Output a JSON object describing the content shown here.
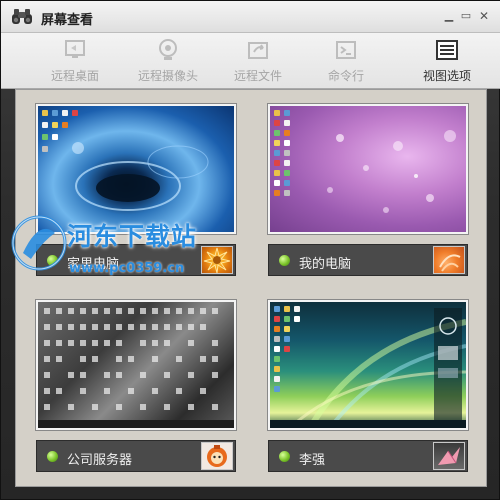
{
  "window": {
    "title": "屏幕查看",
    "controls": {
      "minimize": "▁",
      "maximize": "▭",
      "close": "✕"
    }
  },
  "toolbar": {
    "items": [
      {
        "label": "远程桌面",
        "icon": "remote-desktop-icon",
        "active": false
      },
      {
        "label": "远程摄像头",
        "icon": "webcam-icon",
        "active": false
      },
      {
        "label": "远程文件",
        "icon": "remote-file-icon",
        "active": false
      },
      {
        "label": "命令行",
        "icon": "terminal-icon",
        "active": false
      },
      {
        "label": "视图选项",
        "icon": "view-options-icon",
        "active": true
      }
    ]
  },
  "computers": [
    {
      "name": "家里电脑",
      "status": "online",
      "wallpaper": "blue-water-drop",
      "avatar": "orange-flower"
    },
    {
      "name": "我的电脑",
      "status": "online",
      "wallpaper": "purple-droplets",
      "avatar": "orange-flower"
    },
    {
      "name": "公司服务器",
      "status": "online",
      "wallpaper": "cluttered-grey-desktop",
      "avatar": "cartoon-character"
    },
    {
      "name": "李强",
      "status": "online",
      "wallpaper": "green-aurora",
      "avatar": "pink-origami"
    }
  ],
  "watermark": {
    "text": "河东下载站",
    "url": "www.pc0359.cn"
  },
  "colors": {
    "status_online": "#7cc42a",
    "content_bg": "#d4d0c8",
    "namebar_bg": "#4a4a4a"
  }
}
